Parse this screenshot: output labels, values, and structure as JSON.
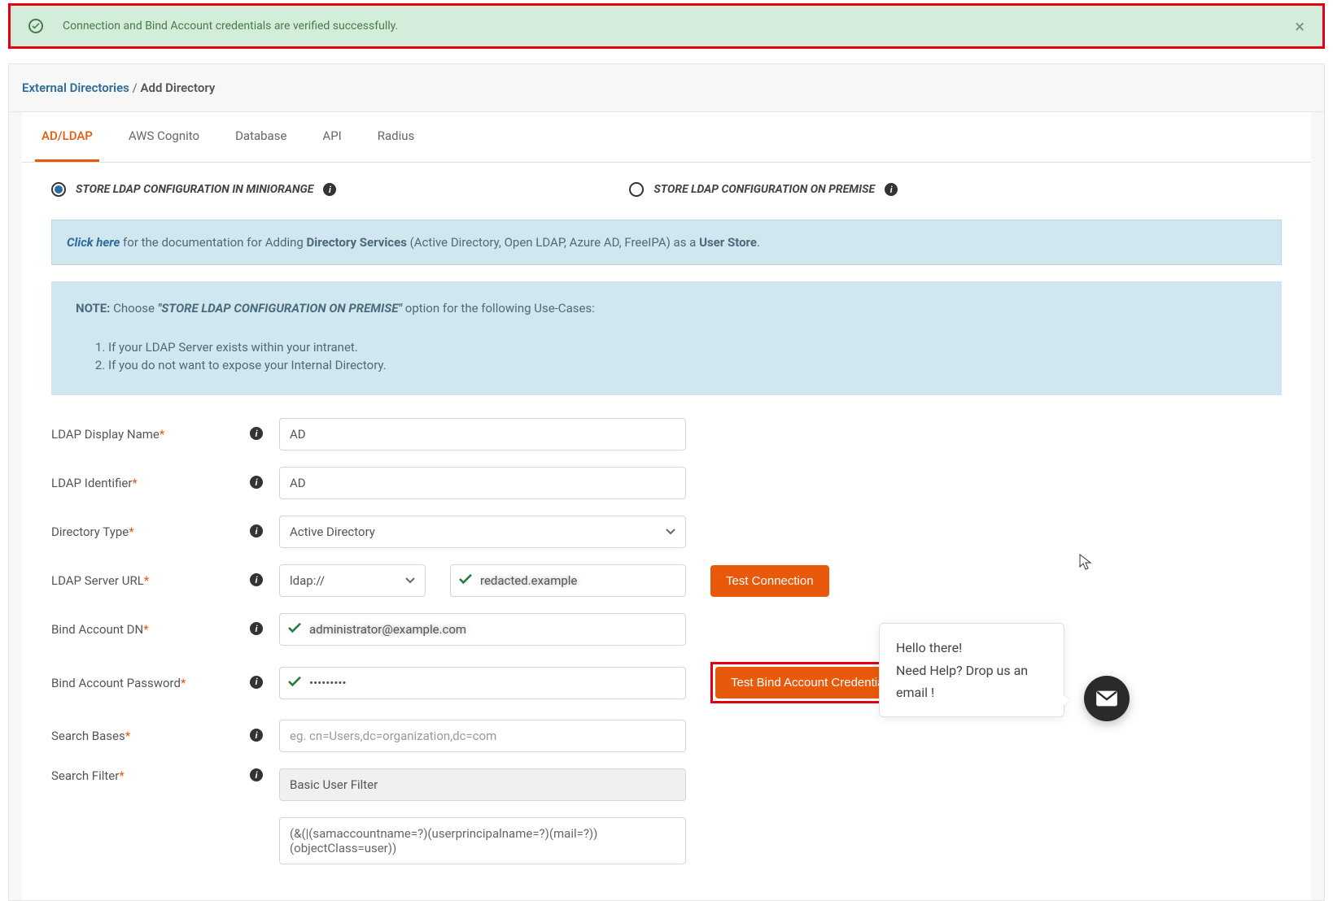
{
  "alert": {
    "message": "Connection and Bind Account credentials are verified successfully."
  },
  "breadcrumb": {
    "parent": "External Directories",
    "sep": "/",
    "current": "Add Directory"
  },
  "tabs": [
    "AD/LDAP",
    "AWS Cognito",
    "Database",
    "API",
    "Radius"
  ],
  "radio": {
    "option1": "STORE LDAP CONFIGURATION IN MINIORANGE",
    "option2": "STORE LDAP CONFIGURATION ON PREMISE"
  },
  "docbox": {
    "click": "Click here",
    "pre": " for the documentation for Adding ",
    "dir": "Directory Services",
    "mid": " (Active Directory, Open LDAP, Azure AD, FreeIPA) as a ",
    "store": "User Store",
    "end": "."
  },
  "notebox": {
    "label": "NOTE:",
    "pre": "  Choose  ",
    "config": "\"STORE LDAP CONFIGURATION ON PREMISE\"",
    "post": " option for the following Use-Cases:",
    "items": [
      "If your LDAP Server exists within your intranet.",
      "If you do not want to expose your Internal Directory."
    ]
  },
  "form": {
    "display_name": {
      "label": "LDAP Display Name",
      "value": "AD"
    },
    "identifier": {
      "label": "LDAP Identifier",
      "value": "AD"
    },
    "dir_type": {
      "label": "Directory Type",
      "value": "Active Directory"
    },
    "server_url": {
      "label": "LDAP Server URL",
      "protocol": "ldap://",
      "value": "redacted.example"
    },
    "test_conn": "Test Connection",
    "bind_dn": {
      "label": "Bind Account DN",
      "value": "administrator@example.com"
    },
    "bind_pw": {
      "label": "Bind Account Password",
      "value": "•••••••••"
    },
    "test_bind": "Test Bind Account Credentials",
    "search_bases": {
      "label": "Search Bases",
      "placeholder": "eg. cn=Users,dc=organization,dc=com"
    },
    "search_filter": {
      "label": "Search Filter",
      "value": "Basic User Filter",
      "expr": "(&(|(samaccountname=?)(userprincipalname=?)(mail=?))(objectClass=user))"
    }
  },
  "chat": {
    "line1": "Hello there!",
    "line2": "Need Help? Drop us an email !"
  }
}
